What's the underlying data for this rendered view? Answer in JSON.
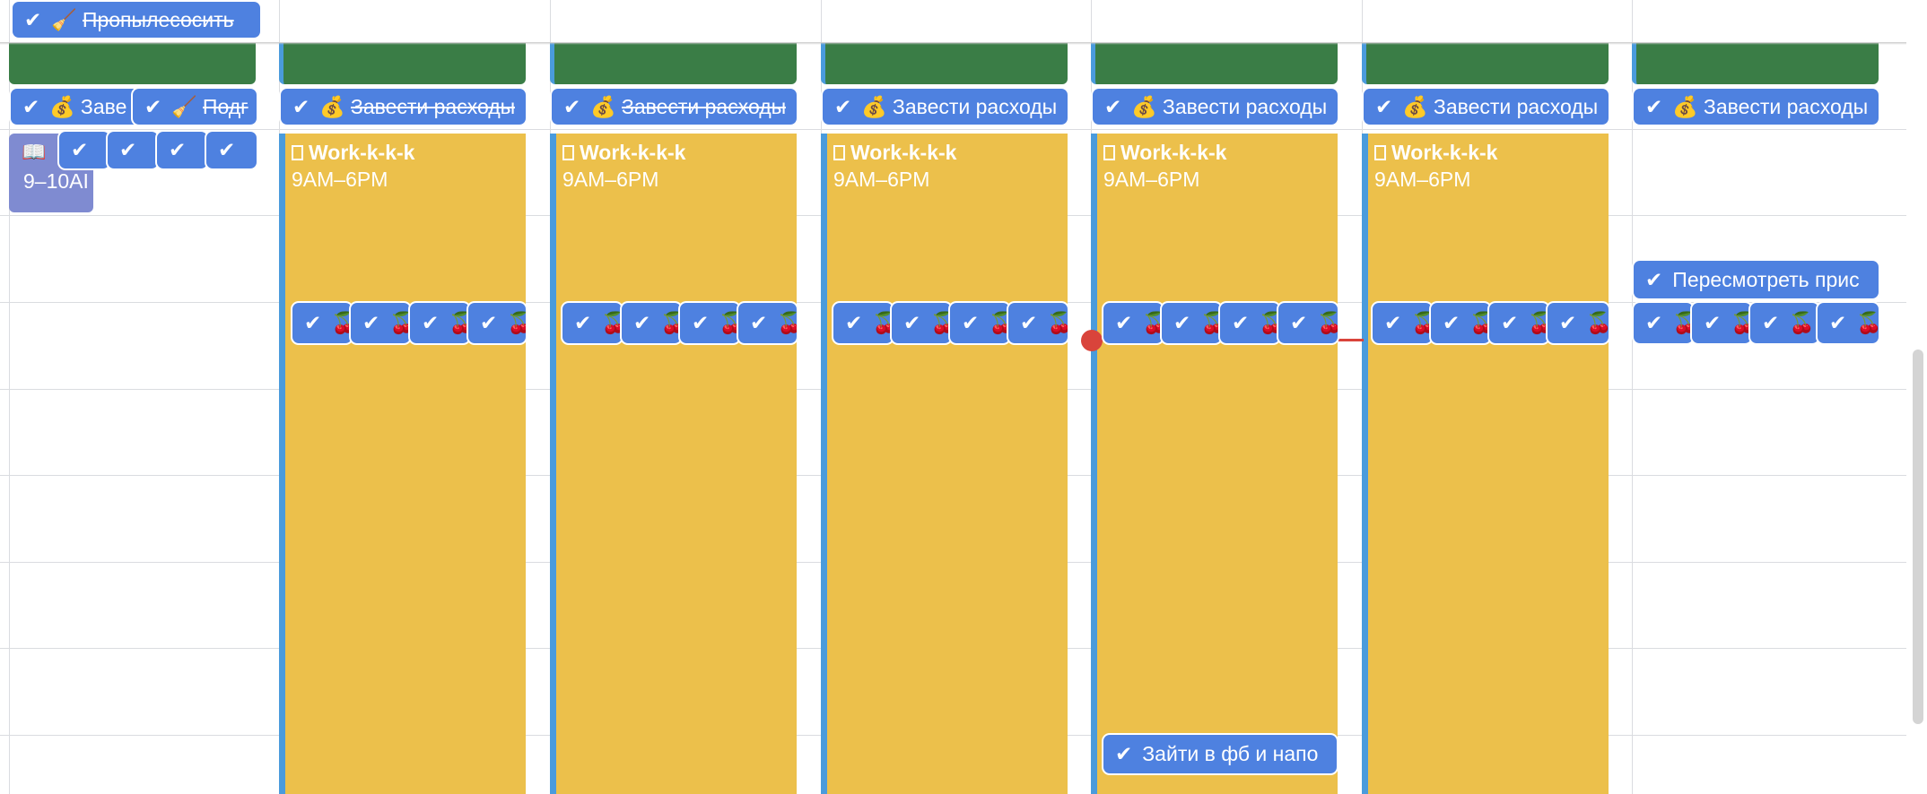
{
  "colors": {
    "task_blue": "#4e81e0",
    "work_yellow": "#ecc04b",
    "green_block": "#3a7d46",
    "lavender": "#7f8bd1",
    "now_red": "#d9443b",
    "accent_stripe": "#4a9bdc"
  },
  "icons": {
    "check": "✔",
    "money": "💰",
    "broom": "🧹",
    "book": "📖",
    "cherry": "🍒"
  },
  "tasks": {
    "vacuum": "Пропылесосить",
    "expenses_short": "Заве",
    "prepare_short": "Подг",
    "expenses": "Завести расходы",
    "review": "Пересмотреть прис",
    "fb": "Зайти в фб и напо"
  },
  "work": {
    "title": "Work-k-k-k",
    "time": "9AM–6PM"
  },
  "lavender_event": {
    "time": "9–10AI"
  }
}
